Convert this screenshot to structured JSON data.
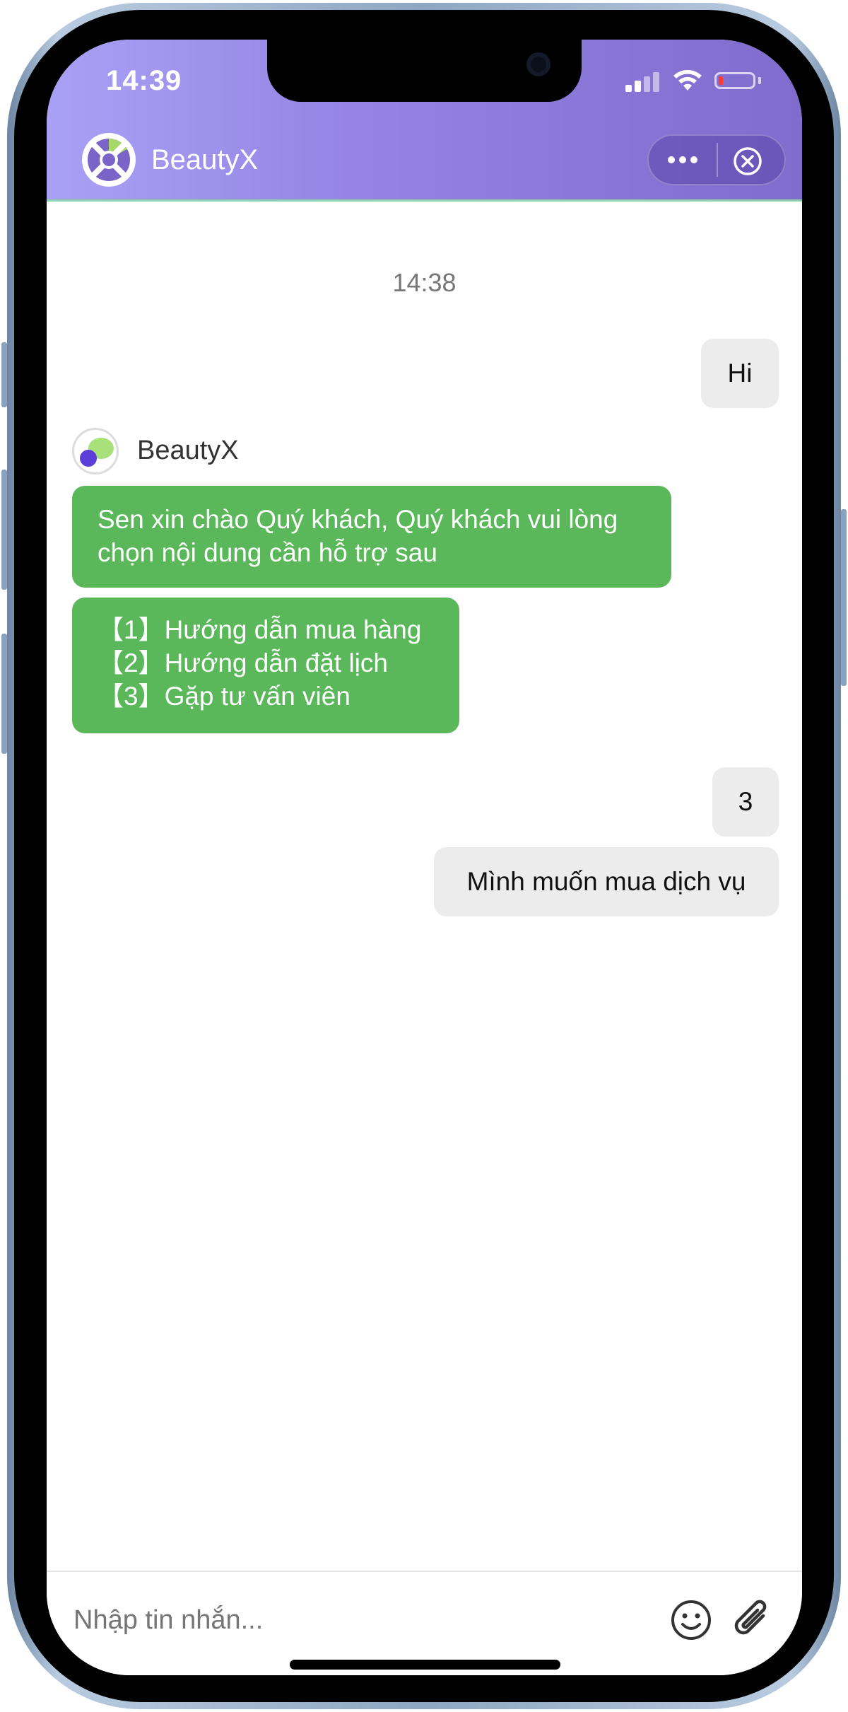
{
  "status_bar": {
    "time": "14:39"
  },
  "header": {
    "title": "BeautyX",
    "more_icon": "ellipsis-icon",
    "close_icon": "close-circle-icon"
  },
  "chat": {
    "timestamp": "14:38",
    "bot_name": "BeautyX",
    "messages": [
      {
        "sender": "user",
        "text": "Hi"
      },
      {
        "sender": "bot",
        "lines": [
          "Sen xin chào Quý khách, Quý khách vui lòng",
          "chọn nội dung cần hỗ trợ sau"
        ]
      },
      {
        "sender": "bot",
        "lines": [
          "【1】Hướng dẫn mua hàng",
          "【2】Hướng dẫn đặt lịch",
          "【3】Gặp tư vấn viên"
        ]
      },
      {
        "sender": "user",
        "text": "3"
      },
      {
        "sender": "user",
        "text": "Mình muốn mua dịch vụ"
      }
    ]
  },
  "input_bar": {
    "placeholder": "Nhập tin nhắn..."
  },
  "colors": {
    "header_start": "#a9a1f5",
    "header_end": "#7f6ccd",
    "bot_bubble": "#5bb85a",
    "user_bubble": "#ececec"
  }
}
